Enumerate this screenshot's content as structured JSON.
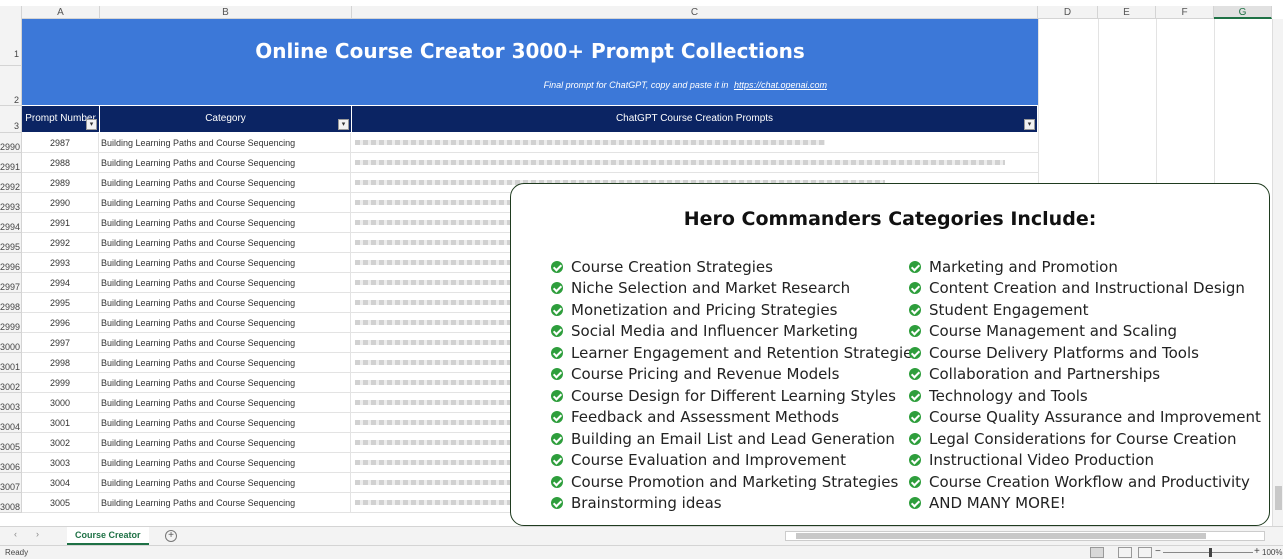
{
  "columns": [
    "A",
    "B",
    "C",
    "D",
    "E",
    "F",
    "G"
  ],
  "title": "Online Course Creator 3000+ Prompt Collections",
  "subtitle": "Final prompt for ChatGPT, copy and paste it in",
  "subtitle_link": "https://chat.openai.com",
  "header_row_numbers": [
    "1",
    "2",
    "3"
  ],
  "headers": {
    "number": "Prompt Number",
    "category": "Category",
    "prompts": "ChatGPT Course Creation Prompts"
  },
  "rows": [
    {
      "row": "2990",
      "num": "2987",
      "cat": "Building Learning Paths and Course Sequencing"
    },
    {
      "row": "2991",
      "num": "2988",
      "cat": "Building Learning Paths and Course Sequencing"
    },
    {
      "row": "2992",
      "num": "2989",
      "cat": "Building Learning Paths and Course Sequencing"
    },
    {
      "row": "2993",
      "num": "2990",
      "cat": "Building Learning Paths and Course Sequencing"
    },
    {
      "row": "2994",
      "num": "2991",
      "cat": "Building Learning Paths and Course Sequencing"
    },
    {
      "row": "2995",
      "num": "2992",
      "cat": "Building Learning Paths and Course Sequencing"
    },
    {
      "row": "2996",
      "num": "2993",
      "cat": "Building Learning Paths and Course Sequencing"
    },
    {
      "row": "2997",
      "num": "2994",
      "cat": "Building Learning Paths and Course Sequencing"
    },
    {
      "row": "2998",
      "num": "2995",
      "cat": "Building Learning Paths and Course Sequencing"
    },
    {
      "row": "2999",
      "num": "2996",
      "cat": "Building Learning Paths and Course Sequencing"
    },
    {
      "row": "3000",
      "num": "2997",
      "cat": "Building Learning Paths and Course Sequencing"
    },
    {
      "row": "3001",
      "num": "2998",
      "cat": "Building Learning Paths and Course Sequencing"
    },
    {
      "row": "3002",
      "num": "2999",
      "cat": "Building Learning Paths and Course Sequencing"
    },
    {
      "row": "3003",
      "num": "3000",
      "cat": "Building Learning Paths and Course Sequencing"
    },
    {
      "row": "3004",
      "num": "3001",
      "cat": "Building Learning Paths and Course Sequencing"
    },
    {
      "row": "3005",
      "num": "3002",
      "cat": "Building Learning Paths and Course Sequencing"
    },
    {
      "row": "3006",
      "num": "3003",
      "cat": "Building Learning Paths and Course Sequencing"
    },
    {
      "row": "3007",
      "num": "3004",
      "cat": "Building Learning Paths and Course Sequencing"
    },
    {
      "row": "3008",
      "num": "3005",
      "cat": "Building Learning Paths and Course Sequencing"
    }
  ],
  "card": {
    "title": "Hero Commanders Categories Include:",
    "left": [
      "Course Creation Strategies",
      "Niche Selection and Market Research",
      "Monetization and Pricing Strategies",
      "Social Media and Influencer Marketing",
      "Learner Engagement and Retention Strategies",
      "Course Pricing and Revenue Models",
      "Course Design for Different Learning Styles",
      "Feedback and Assessment Methods",
      "Building an Email List and Lead Generation",
      "Course Evaluation and Improvement",
      "Course Promotion and Marketing Strategies",
      "Brainstorming ideas"
    ],
    "right": [
      "Marketing and Promotion",
      "Content Creation and Instructional Design",
      "Student Engagement",
      "Course Management and Scaling",
      "Course Delivery Platforms and Tools",
      "Collaboration and Partnerships",
      "Technology and Tools",
      "Course Quality Assurance and Improvement",
      "Legal Considerations for Course Creation",
      "Instructional Video Production",
      "Course Creation Workflow and Productivity",
      "AND MANY MORE!"
    ]
  },
  "sheet_tab": "Course Creator",
  "status": "Ready",
  "zoom": "100%",
  "colors": {
    "title_band": "#3c78d8",
    "header_row": "#0b2463",
    "check": "#2e9e3c",
    "accent": "#1e7145"
  }
}
